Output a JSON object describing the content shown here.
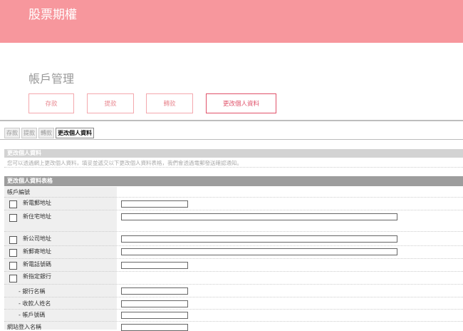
{
  "header": {
    "title": "股票期權"
  },
  "section": {
    "title": "帳戶管理"
  },
  "actions": {
    "deposit": "存款",
    "withdraw": "提款",
    "transfer": "轉款",
    "update": "更改個人資料"
  },
  "tabs": {
    "deposit": "存款",
    "withdraw": "提款",
    "transfer": "轉款",
    "update": "更改個人資料"
  },
  "panel": {
    "heading": "更改個人資料",
    "notice": "您可以透過網上更改個人資料，填妥並遞交以下更改個人資料表格，我們會透過電郵發送確認通知。"
  },
  "form": {
    "heading": "更改個人資料表格",
    "account_no": "帳戶編號",
    "new_email": "新電郵地址",
    "new_home_address": "新住宅地址",
    "new_office_address": "新公司地址",
    "new_mailing_address": "新郵寄地址",
    "new_phone": "新電話號碼",
    "new_bank": "新指定銀行",
    "bank_name": "- 銀行名稱",
    "payee_name": "- 收款人姓名",
    "bank_account_no": "- 帳戶號碼",
    "online_login": "網站登入名稱"
  }
}
